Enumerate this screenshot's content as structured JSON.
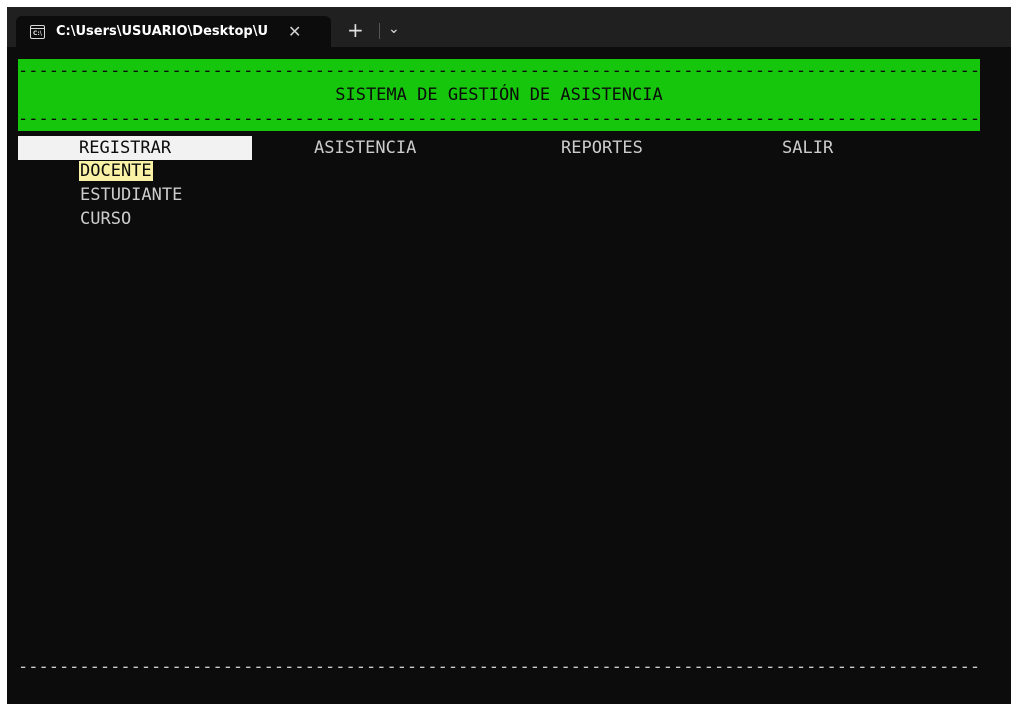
{
  "window": {
    "tab_title": "C:\\Users\\USUARIO\\Desktop\\U",
    "tab_icon": "terminal-icon",
    "close_glyph": "✕",
    "new_tab_glyph": "+",
    "dropdown_glyph": "⌄"
  },
  "banner": {
    "dashes": "----------------------------------------------------------------------------------------------------------------------------",
    "title": "SISTEMA DE GESTIÓN DE ASISTENCIA",
    "color": "#16c60c"
  },
  "menu": {
    "items": [
      "REGISTRAR",
      "ASISTENCIA",
      "REPORTES",
      "SALIR"
    ],
    "selected": "REGISTRAR"
  },
  "submenu": {
    "items": [
      "DOCENTE",
      "ESTUDIANTE",
      "CURSO"
    ],
    "highlighted": "DOCENTE"
  },
  "footer": {
    "dashes": "----------------------------------------------------------------------------------------------------------------------------"
  }
}
